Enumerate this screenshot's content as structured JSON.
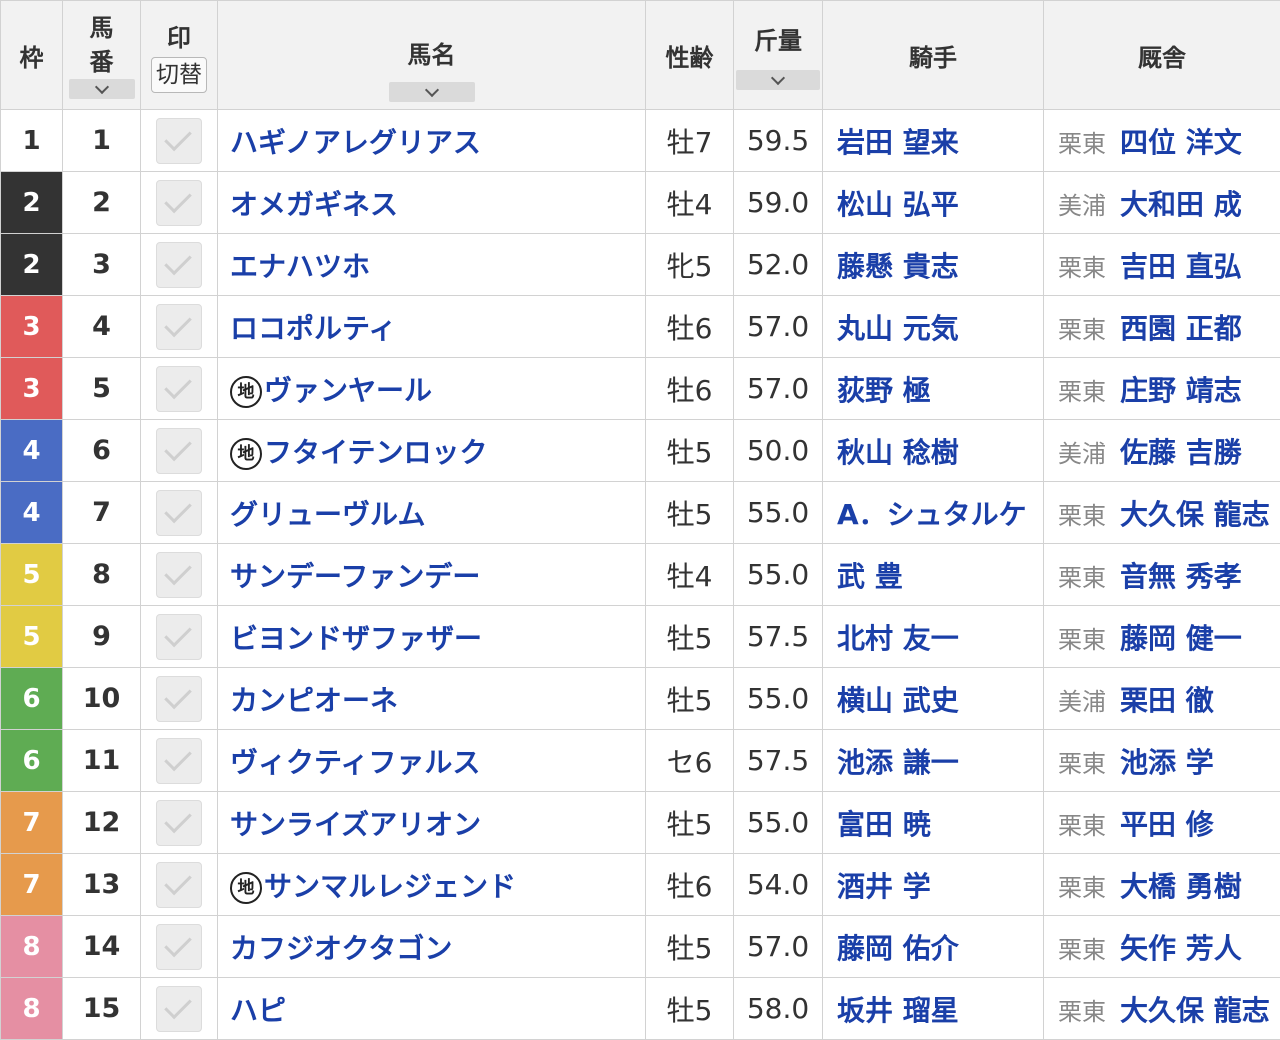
{
  "headers": {
    "waku": "枠",
    "umaban_top": "馬",
    "umaban_bottom": "番",
    "mark": "印",
    "mark_toggle": "切替",
    "horse": "馬名",
    "sexage": "性齢",
    "weight": "斤量",
    "jockey": "騎手",
    "trainer": "厩舎"
  },
  "local_mark": "地",
  "waku_colors": {
    "1": "#ffffff",
    "2": "#333333",
    "3": "#e05a5a",
    "4": "#4a6cc4",
    "5": "#e1cb43",
    "6": "#5fac53",
    "7": "#e69a4c",
    "8": "#e58fa3"
  },
  "rows": [
    {
      "waku": "1",
      "num": "1",
      "horse": "ハギノアレグリアス",
      "local": false,
      "sexage": "牡7",
      "weight": "59.5",
      "jockey": "岩田 望来",
      "region": "栗東",
      "trainer": "四位 洋文"
    },
    {
      "waku": "2",
      "num": "2",
      "horse": "オメガギネス",
      "local": false,
      "sexage": "牡4",
      "weight": "59.0",
      "jockey": "松山 弘平",
      "region": "美浦",
      "trainer": "大和田 成"
    },
    {
      "waku": "2",
      "num": "3",
      "horse": "エナハツホ",
      "local": false,
      "sexage": "牝5",
      "weight": "52.0",
      "jockey": "藤懸 貴志",
      "region": "栗東",
      "trainer": "吉田 直弘"
    },
    {
      "waku": "3",
      "num": "4",
      "horse": "ロコポルティ",
      "local": false,
      "sexage": "牡6",
      "weight": "57.0",
      "jockey": "丸山 元気",
      "region": "栗東",
      "trainer": "西園 正都"
    },
    {
      "waku": "3",
      "num": "5",
      "horse": "ヴァンヤール",
      "local": true,
      "sexage": "牡6",
      "weight": "57.0",
      "jockey": "荻野 極",
      "region": "栗東",
      "trainer": "庄野 靖志"
    },
    {
      "waku": "4",
      "num": "6",
      "horse": "フタイテンロック",
      "local": true,
      "sexage": "牡5",
      "weight": "50.0",
      "jockey": "秋山 稔樹",
      "region": "美浦",
      "trainer": "佐藤 吉勝"
    },
    {
      "waku": "4",
      "num": "7",
      "horse": "グリューヴルム",
      "local": false,
      "sexage": "牡5",
      "weight": "55.0",
      "jockey": "A．シュタルケ",
      "region": "栗東",
      "trainer": "大久保 龍志"
    },
    {
      "waku": "5",
      "num": "8",
      "horse": "サンデーファンデー",
      "local": false,
      "sexage": "牡4",
      "weight": "55.0",
      "jockey": "武 豊",
      "region": "栗東",
      "trainer": "音無 秀孝"
    },
    {
      "waku": "5",
      "num": "9",
      "horse": "ビヨンドザファザー",
      "local": false,
      "sexage": "牡5",
      "weight": "57.5",
      "jockey": "北村 友一",
      "region": "栗東",
      "trainer": "藤岡 健一"
    },
    {
      "waku": "6",
      "num": "10",
      "horse": "カンピオーネ",
      "local": false,
      "sexage": "牡5",
      "weight": "55.0",
      "jockey": "横山 武史",
      "region": "美浦",
      "trainer": "栗田 徹"
    },
    {
      "waku": "6",
      "num": "11",
      "horse": "ヴィクティファルス",
      "local": false,
      "sexage": "セ6",
      "weight": "57.5",
      "jockey": "池添 謙一",
      "region": "栗東",
      "trainer": "池添 学"
    },
    {
      "waku": "7",
      "num": "12",
      "horse": "サンライズアリオン",
      "local": false,
      "sexage": "牡5",
      "weight": "55.0",
      "jockey": "富田 暁",
      "region": "栗東",
      "trainer": "平田 修"
    },
    {
      "waku": "7",
      "num": "13",
      "horse": "サンマルレジェンド",
      "local": true,
      "sexage": "牡6",
      "weight": "54.0",
      "jockey": "酒井 学",
      "region": "栗東",
      "trainer": "大橋 勇樹"
    },
    {
      "waku": "8",
      "num": "14",
      "horse": "カフジオクタゴン",
      "local": false,
      "sexage": "牡5",
      "weight": "57.0",
      "jockey": "藤岡 佑介",
      "region": "栗東",
      "trainer": "矢作 芳人"
    },
    {
      "waku": "8",
      "num": "15",
      "horse": "ハピ",
      "local": false,
      "sexage": "牡5",
      "weight": "58.0",
      "jockey": "坂井 瑠星",
      "region": "栗東",
      "trainer": "大久保 龍志"
    }
  ]
}
